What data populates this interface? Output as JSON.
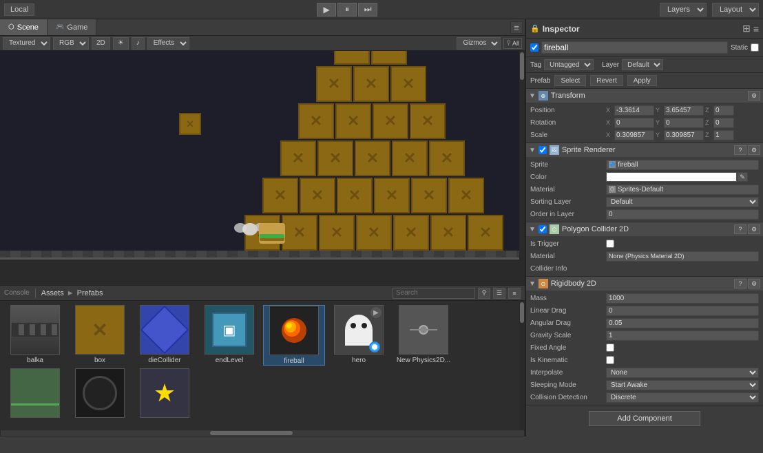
{
  "topbar": {
    "local_label": "Local",
    "transport": {
      "play": "▶",
      "pause": "⏸",
      "step": "⏭"
    },
    "layers_label": "Layers",
    "layout_label": "Layout"
  },
  "tabs": [
    {
      "label": "Scene",
      "icon": "⬡",
      "active": true
    },
    {
      "label": "Game",
      "icon": "🎮",
      "active": false
    }
  ],
  "scene_toolbar": {
    "textured_label": "Textured",
    "rgb_label": "RGB",
    "two_d_label": "2D",
    "light_icon": "☀",
    "audio_icon": "♪",
    "effects_label": "Effects",
    "gizmos_label": "Gizmos",
    "all_label": "All"
  },
  "bottom_panel": {
    "console_label": "Console",
    "path": [
      "Assets",
      "Prefabs"
    ],
    "search_placeholder": "Search",
    "assets": [
      {
        "id": "balka",
        "label": "balka",
        "type": "balka"
      },
      {
        "id": "box",
        "label": "box",
        "type": "box"
      },
      {
        "id": "dieCollider",
        "label": "dieCollider",
        "type": "die"
      },
      {
        "id": "endLevel",
        "label": "endLevel",
        "type": "endlevel"
      },
      {
        "id": "fireball",
        "label": "fireball",
        "type": "fireball"
      },
      {
        "id": "hero",
        "label": "hero",
        "type": "hero"
      },
      {
        "id": "NewPhysics2D",
        "label": "New Physics2D...",
        "type": "physics"
      },
      {
        "id": "ground2",
        "label": "",
        "type": "ground"
      },
      {
        "id": "circle",
        "label": "",
        "type": "circle"
      },
      {
        "id": "star",
        "label": "",
        "type": "star"
      }
    ]
  },
  "inspector": {
    "title": "Inspector",
    "object_name": "fireball",
    "static_label": "Static",
    "tag_label": "Tag",
    "tag_value": "Untagged",
    "layer_label": "Layer",
    "layer_value": "Default",
    "prefab_label": "Prefab",
    "select_label": "Select",
    "revert_label": "Revert",
    "apply_label": "Apply",
    "transform": {
      "label": "Transform",
      "position_label": "Position",
      "pos_x": "-3.3614",
      "pos_y": "3.65457",
      "pos_z": "0",
      "rotation_label": "Rotation",
      "rot_x": "0",
      "rot_y": "0",
      "rot_z": "0",
      "scale_label": "Scale",
      "scale_x": "0.309857",
      "scale_y": "0.309857",
      "scale_z": "1"
    },
    "sprite_renderer": {
      "label": "Sprite Renderer",
      "sprite_label": "Sprite",
      "sprite_value": "fireball",
      "color_label": "Color",
      "material_label": "Material",
      "material_value": "Sprites-Default",
      "sorting_layer_label": "Sorting Layer",
      "sorting_layer_value": "Default",
      "order_in_layer_label": "Order in Layer",
      "order_in_layer_value": "0"
    },
    "polygon_collider": {
      "label": "Polygon Collider 2D",
      "is_trigger_label": "Is Trigger",
      "material_label": "Material",
      "material_value": "None (Physics Material 2D)",
      "collider_info_label": "Collider Info"
    },
    "rigidbody2d": {
      "label": "Rigidbody 2D",
      "mass_label": "Mass",
      "mass_value": "1000",
      "linear_drag_label": "Linear Drag",
      "linear_drag_value": "0",
      "angular_drag_label": "Angular Drag",
      "angular_drag_value": "0.05",
      "gravity_scale_label": "Gravity Scale",
      "gravity_scale_value": "1",
      "fixed_angle_label": "Fixed Angle",
      "is_kinematic_label": "Is Kinematic",
      "interpolate_label": "Interpolate",
      "interpolate_value": "None",
      "sleeping_mode_label": "Sleeping Mode",
      "sleeping_mode_value": "Start Awake",
      "collision_detection_label": "Collision Detection",
      "collision_detection_value": "Discrete"
    },
    "add_component_label": "Add Component"
  }
}
